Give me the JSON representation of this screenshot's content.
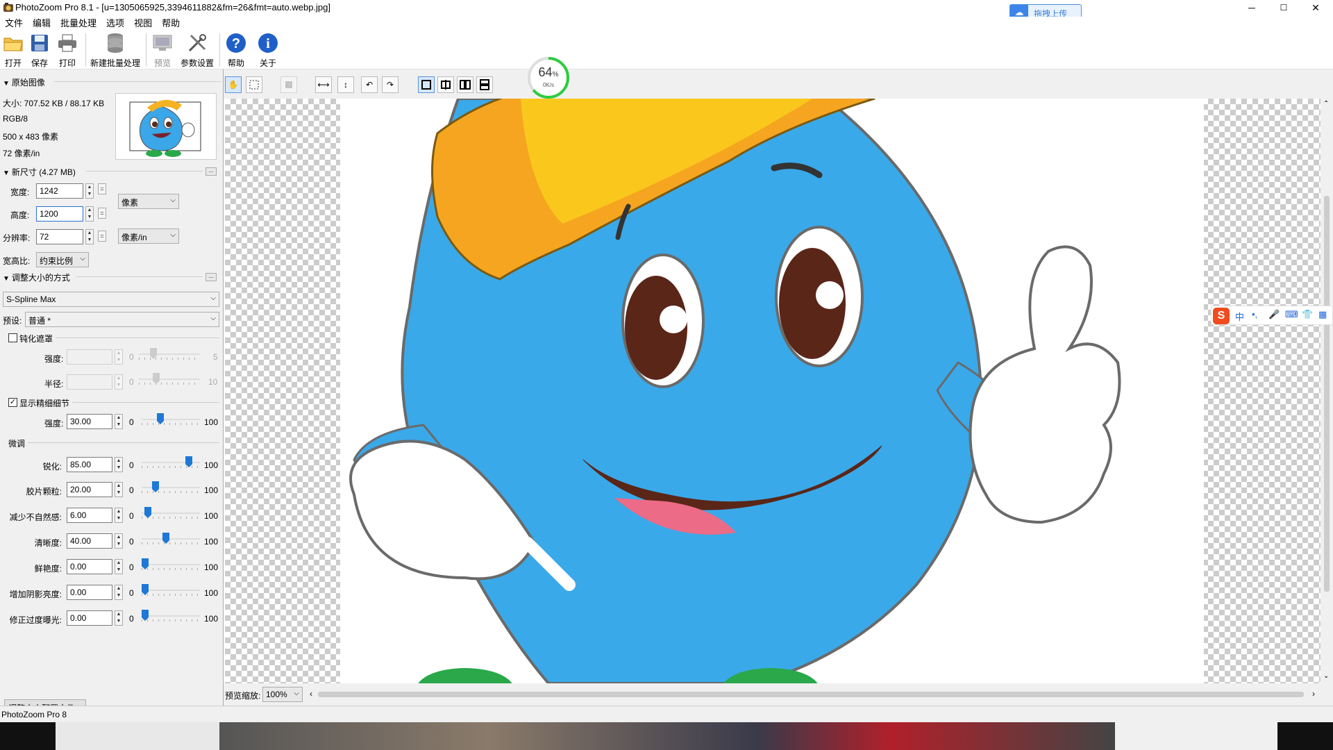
{
  "window": {
    "title": "PhotoZoom Pro 8.1 - [u=1305065925,3394611882&fm=26&fmt=auto.webp.jpg]",
    "upload_label": "拖拽上传",
    "controls": {
      "minimize": "─",
      "maximize": "☐",
      "close": "✕"
    }
  },
  "menu": [
    "文件",
    "编辑",
    "批量处理",
    "选项",
    "视图",
    "帮助"
  ],
  "toolbar": {
    "open": "打开",
    "save": "保存",
    "print": "打印",
    "batch": "新建批量处理",
    "preview": "预览",
    "settings": "参数设置",
    "help": "帮助",
    "about": "关于"
  },
  "original": {
    "header": "原始图像",
    "size": "大小: 707.52 KB / 88.17 KB",
    "mode": "RGB/8",
    "dims": "500 x 483 像素",
    "res": "72 像素/in"
  },
  "newsize": {
    "header": "新尺寸 (4.27 MB)",
    "width_label": "宽度:",
    "width": "1242",
    "height_label": "高度:",
    "height": "1200",
    "res_label": "分辨率:",
    "res": "72",
    "unit": "像素",
    "res_unit": "像素/in",
    "aspect_label": "宽高比:",
    "aspect": "约束比例"
  },
  "method": {
    "header": "调整大小的方式",
    "algorithm": "S-Spline Max",
    "preset_label": "预设:",
    "preset": "普通 *"
  },
  "unsharp": {
    "label": "钝化遮罩",
    "checked": false,
    "strength_label": "强度:",
    "radius_label": "半径:",
    "strength_min": "0",
    "strength_max": "5",
    "radius_min": "0",
    "radius_max": "10"
  },
  "fine_detail": {
    "label": "显示精细细节",
    "checked": true,
    "strength_label": "强度:",
    "strength": "30.00",
    "min": "0",
    "max": "100",
    "level": 0.3
  },
  "tuning": {
    "header": "微调",
    "rows": [
      {
        "label": "锐化:",
        "value": "85.00",
        "min": "0",
        "max": "100",
        "level": 0.85
      },
      {
        "label": "胶片颗粒:",
        "value": "20.00",
        "min": "0",
        "max": "100",
        "level": 0.2
      },
      {
        "label": "减少不自然感:",
        "value": "6.00",
        "min": "0",
        "max": "100",
        "level": 0.06
      },
      {
        "label": "清晰度:",
        "value": "40.00",
        "min": "0",
        "max": "100",
        "level": 0.4
      },
      {
        "label": "鲜艳度:",
        "value": "0.00",
        "min": "0",
        "max": "100",
        "level": 0.0
      },
      {
        "label": "增加阴影亮度:",
        "value": "0.00",
        "min": "0",
        "max": "100",
        "level": 0.0
      },
      {
        "label": "修正过度曝光:",
        "value": "0.00",
        "min": "0",
        "max": "100",
        "level": 0.0
      }
    ],
    "profile_button": "调整大小配置文件..."
  },
  "progress": {
    "percent": "64",
    "unit": "%",
    "speed": "0K/s",
    "level": 0.64
  },
  "preview": {
    "zoom_label": "预览缩放:",
    "zoom": "100%"
  },
  "status": "PhotoZoom Pro 8",
  "ime": {
    "items": [
      "中",
      "•,",
      "🎤",
      "⌨",
      "👕",
      "▦"
    ]
  },
  "colors": {
    "accent": "#1e78d7",
    "progress": "#2ecc40"
  }
}
